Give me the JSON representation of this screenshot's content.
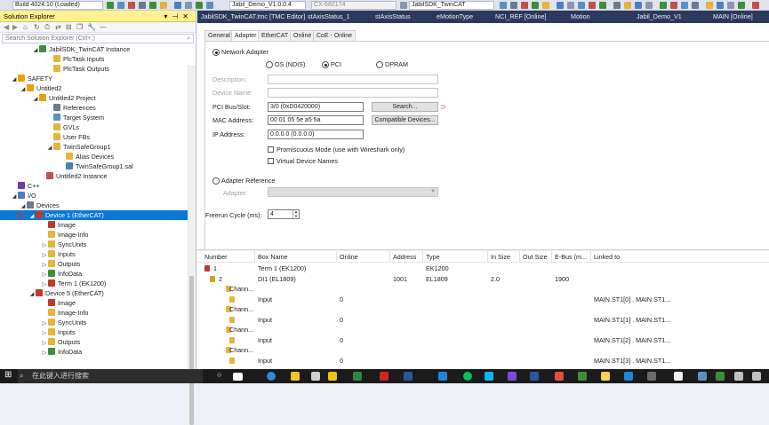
{
  "toolbar": {
    "build": "Build 4024.10 (Loaded)",
    "project_combo": "Jabil_Demo_V1.0.0.4",
    "cx_combo": "CX-582174",
    "target_combo": "JabilSDK_TwinCAT"
  },
  "solution_explorer": {
    "title": "Solution Explorer",
    "search_placeholder": "Search Solution Explorer (Ctrl+;)",
    "items": [
      {
        "label": "JabilSDK_TwinCAT Instance",
        "icon": "instance-icon",
        "color": "#3f8f3a"
      },
      {
        "label": "PlcTask Inputs",
        "icon": "folder-icon",
        "color": "#e6b43c"
      },
      {
        "label": "PlcTask Outputs",
        "icon": "folder-icon",
        "color": "#e6b43c"
      },
      {
        "label": "SAFETY",
        "icon": "safety-icon",
        "color": "#e8a400"
      },
      {
        "label": "Untitled2",
        "icon": "safety-project-icon",
        "color": "#e8a400"
      },
      {
        "label": "Untitled2 Project",
        "icon": "safety-project-icon",
        "color": "#e8a400"
      },
      {
        "label": "References",
        "icon": "references-icon",
        "color": "#6b7a8f"
      },
      {
        "label": "Target System",
        "icon": "target-icon",
        "color": "#5a8fc2"
      },
      {
        "label": "GVLs",
        "icon": "folder-icon",
        "color": "#e6b43c"
      },
      {
        "label": "User FBs",
        "icon": "folder-icon",
        "color": "#e6b43c"
      },
      {
        "label": "TwinSafeGroup1",
        "icon": "folder-icon",
        "color": "#e6b43c"
      },
      {
        "label": "Alias Devices",
        "icon": "folder-icon",
        "color": "#e6b43c"
      },
      {
        "label": "TwinSafeGroup1.sal",
        "icon": "file-icon",
        "color": "#4a7fc0"
      },
      {
        "label": "Untitled2 Instance",
        "icon": "instance-icon",
        "color": "#c0504d"
      },
      {
        "label": "C++",
        "icon": "cpp-icon",
        "color": "#6c3fa0"
      },
      {
        "label": "I/O",
        "icon": "io-icon",
        "color": "#4a7fc0"
      },
      {
        "label": "Devices",
        "icon": "devices-icon",
        "color": "#6b7a8f"
      },
      {
        "label": "Device 1 (EtherCAT)",
        "icon": "ethercat-icon",
        "color": "#c0392b"
      },
      {
        "label": "Image",
        "icon": "image-icon",
        "color": "#c0392b"
      },
      {
        "label": "Image-Info",
        "icon": "image-info-icon",
        "color": "#e6b43c"
      },
      {
        "label": "SyncUnits",
        "icon": "syncunits-icon",
        "color": "#e6b43c"
      },
      {
        "label": "Inputs",
        "icon": "inputs-icon",
        "color": "#e6b43c"
      },
      {
        "label": "Outputs",
        "icon": "outputs-icon",
        "color": "#e6b43c"
      },
      {
        "label": "InfoData",
        "icon": "infodata-icon",
        "color": "#3f8f3a"
      },
      {
        "label": "Term 1 (EK1200)",
        "icon": "terminal-icon",
        "color": "#c0392b"
      },
      {
        "label": "Device 5 (EtherCAT)",
        "icon": "ethercat-icon",
        "color": "#c0392b"
      },
      {
        "label": "Image",
        "icon": "image-icon",
        "color": "#c0392b"
      },
      {
        "label": "Image-Info",
        "icon": "image-info-icon",
        "color": "#e6b43c"
      },
      {
        "label": "SyncUnits",
        "icon": "syncunits-icon",
        "color": "#e6b43c"
      },
      {
        "label": "Inputs",
        "icon": "inputs-icon",
        "color": "#e6b43c"
      },
      {
        "label": "Outputs",
        "icon": "outputs-icon",
        "color": "#e6b43c"
      },
      {
        "label": "InfoData",
        "icon": "infodata-icon",
        "color": "#3f8f3a"
      }
    ]
  },
  "doc_tabs": [
    "JabilSDK_TwinCAT.tmc [TMC Editor]",
    "stAxisStatus_1",
    "stAxisStatus",
    "eMotionType",
    "NCI_REF [Online]",
    "Motion",
    "Jabil_Demo_V1",
    "MAIN [Online]"
  ],
  "sub_tabs": [
    "General",
    "Adapter",
    "EtherCAT",
    "Online",
    "CoE - Online"
  ],
  "adapter": {
    "network_adapter": "Network Adapter",
    "os_ndis": "OS (NDIS)",
    "pci": "PCI",
    "dpram": "DPRAM",
    "description_label": "Description:",
    "device_name_label": "Device Name:",
    "pci_bus_label": "PCI Bus/Slot:",
    "pci_bus_value": "3/0 (0xD0420000)",
    "search_button": "Search...",
    "mac_label": "MAC Address:",
    "mac_value": "00 01 05 5e a5 5a",
    "compatible_button": "Compatible Devices...",
    "ip_label": "IP Address:",
    "ip_value": "0.0.0.0 (0.0.0.0)",
    "promiscuous": "Promiscuous Mode (use with Wireshark only)",
    "virtual_names": "Virtual Device Names",
    "adapter_reference": "Adapter Reference",
    "adapter_label": "Adapter:",
    "freerun_label": "Freerun Cycle (ms):",
    "freerun_value": "4"
  },
  "table": {
    "columns": [
      "Number",
      "Box Name",
      "Online",
      "Address",
      "Type",
      "In Size",
      "Out Size",
      "E-Bus (m...",
      "Linked to"
    ],
    "rows": [
      {
        "number": "1",
        "box": "Term 1 (EK1200)",
        "online": "",
        "address": "",
        "type": "EK1200",
        "in": "",
        "out": "",
        "ebus": "",
        "linked": "",
        "indent": 0,
        "icon_color": "#c0392b"
      },
      {
        "number": "2",
        "box": "DI1 (EL1809)",
        "online": "",
        "address": "1001",
        "type": "EL1809",
        "in": "2.0",
        "out": "",
        "ebus": "1900",
        "linked": "",
        "indent": 1,
        "icon_color": "#c9a227"
      },
      {
        "number": "",
        "box": "Chann...",
        "online": "",
        "address": "",
        "type": "",
        "in": "",
        "out": "",
        "ebus": "",
        "linked": "",
        "indent": 2,
        "icon_color": "#e6b43c"
      },
      {
        "number": "",
        "box": "Input",
        "online": "0",
        "address": "",
        "type": "",
        "in": "",
        "out": "",
        "ebus": "",
        "linked": "MAIN.ST1[0] . MAIN.ST1...",
        "indent": 3,
        "icon_color": "#e6b43c"
      },
      {
        "number": "",
        "box": "Chann...",
        "online": "",
        "address": "",
        "type": "",
        "in": "",
        "out": "",
        "ebus": "",
        "linked": "",
        "indent": 2,
        "icon_color": "#e6b43c"
      },
      {
        "number": "",
        "box": "Input",
        "online": "0",
        "address": "",
        "type": "",
        "in": "",
        "out": "",
        "ebus": "",
        "linked": "MAIN.ST1[1] . MAIN.ST1...",
        "indent": 3,
        "icon_color": "#e6b43c"
      },
      {
        "number": "",
        "box": "Chann...",
        "online": "",
        "address": "",
        "type": "",
        "in": "",
        "out": "",
        "ebus": "",
        "linked": "",
        "indent": 2,
        "icon_color": "#e6b43c"
      },
      {
        "number": "",
        "box": "Input",
        "online": "0",
        "address": "",
        "type": "",
        "in": "",
        "out": "",
        "ebus": "",
        "linked": "MAIN.ST1[2] . MAIN.ST1...",
        "indent": 3,
        "icon_color": "#e6b43c"
      },
      {
        "number": "",
        "box": "Chann...",
        "online": "",
        "address": "",
        "type": "",
        "in": "",
        "out": "",
        "ebus": "",
        "linked": "",
        "indent": 2,
        "icon_color": "#e6b43c"
      },
      {
        "number": "",
        "box": "Input",
        "online": "0",
        "address": "",
        "type": "",
        "in": "",
        "out": "",
        "ebus": "",
        "linked": "MAIN.ST1[3] . MAIN.ST1...",
        "indent": 3,
        "icon_color": "#e6b43c"
      }
    ]
  },
  "taskbar": {
    "search_placeholder": "在此键入进行搜索"
  }
}
